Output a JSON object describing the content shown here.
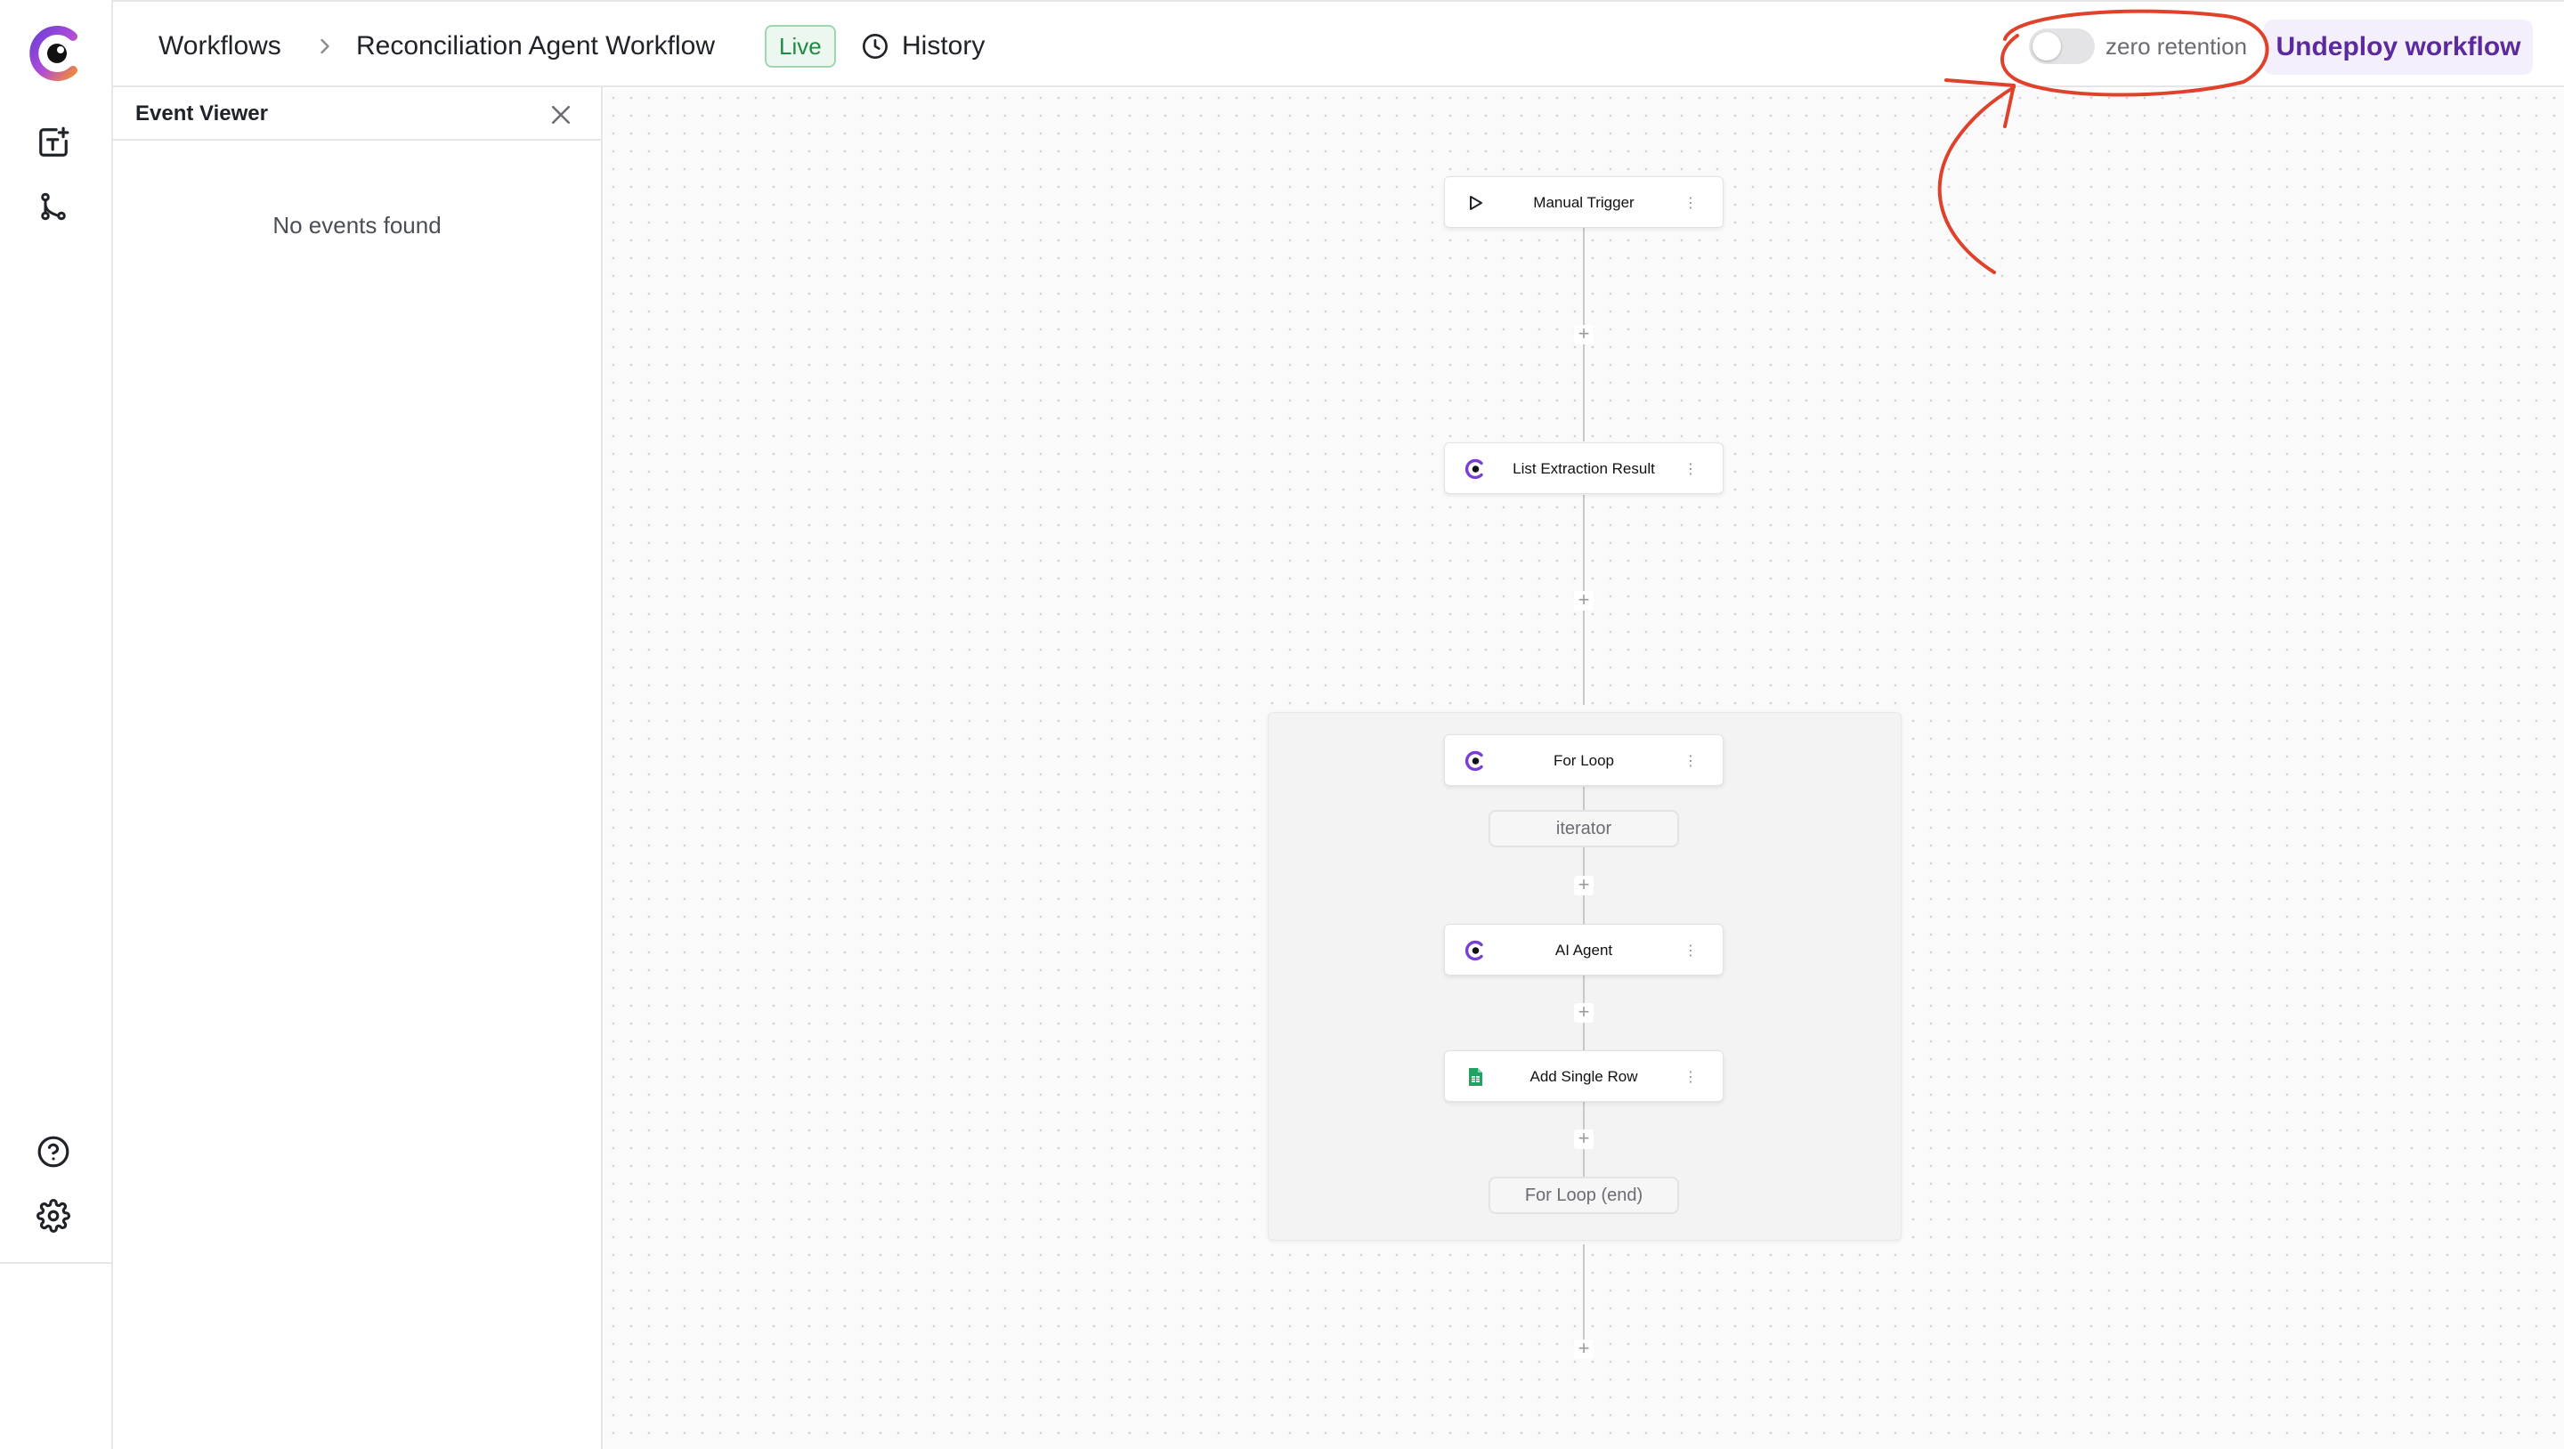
{
  "header": {
    "breadcrumb_root": "Workflows",
    "breadcrumb_current": "Reconciliation Agent Workflow",
    "status_badge": "Live",
    "history_label": "History",
    "zero_retention_label": "zero retention",
    "zero_retention_on": false,
    "undeploy_label": "Undeploy workflow"
  },
  "event_viewer": {
    "title": "Event Viewer",
    "empty_text": "No events found"
  },
  "workflow": {
    "nodes": [
      {
        "label": "Manual Trigger",
        "icon": "play-icon"
      },
      {
        "label": "List Extraction Result",
        "icon": "app-logo-icon"
      },
      {
        "label": "For Loop",
        "icon": "app-logo-icon"
      },
      {
        "label": "AI Agent",
        "icon": "app-logo-icon"
      },
      {
        "label": "Add Single Row",
        "icon": "sheets-icon"
      }
    ],
    "iterator_label": "iterator",
    "loop_end_label": "For Loop (end)"
  },
  "colors": {
    "accent": "#5b2a9e",
    "live_green": "#1f8a44",
    "annotation_red": "#e0412b"
  }
}
